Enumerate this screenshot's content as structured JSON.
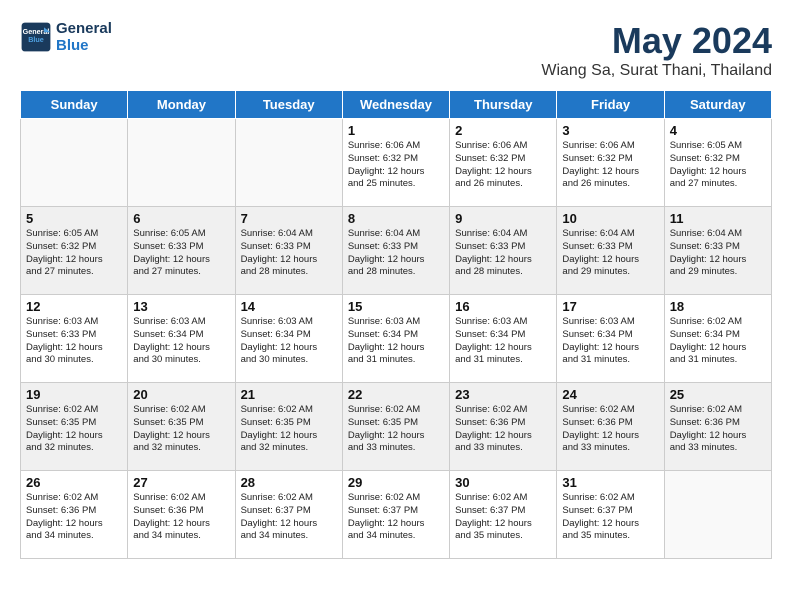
{
  "header": {
    "logo_line1": "General",
    "logo_line2": "Blue",
    "title": "May 2024",
    "subtitle": "Wiang Sa, Surat Thani, Thailand"
  },
  "days_of_week": [
    "Sunday",
    "Monday",
    "Tuesday",
    "Wednesday",
    "Thursday",
    "Friday",
    "Saturday"
  ],
  "weeks": [
    [
      {
        "num": "",
        "info": ""
      },
      {
        "num": "",
        "info": ""
      },
      {
        "num": "",
        "info": ""
      },
      {
        "num": "1",
        "info": "Sunrise: 6:06 AM\nSunset: 6:32 PM\nDaylight: 12 hours\nand 25 minutes."
      },
      {
        "num": "2",
        "info": "Sunrise: 6:06 AM\nSunset: 6:32 PM\nDaylight: 12 hours\nand 26 minutes."
      },
      {
        "num": "3",
        "info": "Sunrise: 6:06 AM\nSunset: 6:32 PM\nDaylight: 12 hours\nand 26 minutes."
      },
      {
        "num": "4",
        "info": "Sunrise: 6:05 AM\nSunset: 6:32 PM\nDaylight: 12 hours\nand 27 minutes."
      }
    ],
    [
      {
        "num": "5",
        "info": "Sunrise: 6:05 AM\nSunset: 6:32 PM\nDaylight: 12 hours\nand 27 minutes."
      },
      {
        "num": "6",
        "info": "Sunrise: 6:05 AM\nSunset: 6:33 PM\nDaylight: 12 hours\nand 27 minutes."
      },
      {
        "num": "7",
        "info": "Sunrise: 6:04 AM\nSunset: 6:33 PM\nDaylight: 12 hours\nand 28 minutes."
      },
      {
        "num": "8",
        "info": "Sunrise: 6:04 AM\nSunset: 6:33 PM\nDaylight: 12 hours\nand 28 minutes."
      },
      {
        "num": "9",
        "info": "Sunrise: 6:04 AM\nSunset: 6:33 PM\nDaylight: 12 hours\nand 28 minutes."
      },
      {
        "num": "10",
        "info": "Sunrise: 6:04 AM\nSunset: 6:33 PM\nDaylight: 12 hours\nand 29 minutes."
      },
      {
        "num": "11",
        "info": "Sunrise: 6:04 AM\nSunset: 6:33 PM\nDaylight: 12 hours\nand 29 minutes."
      }
    ],
    [
      {
        "num": "12",
        "info": "Sunrise: 6:03 AM\nSunset: 6:33 PM\nDaylight: 12 hours\nand 30 minutes."
      },
      {
        "num": "13",
        "info": "Sunrise: 6:03 AM\nSunset: 6:34 PM\nDaylight: 12 hours\nand 30 minutes."
      },
      {
        "num": "14",
        "info": "Sunrise: 6:03 AM\nSunset: 6:34 PM\nDaylight: 12 hours\nand 30 minutes."
      },
      {
        "num": "15",
        "info": "Sunrise: 6:03 AM\nSunset: 6:34 PM\nDaylight: 12 hours\nand 31 minutes."
      },
      {
        "num": "16",
        "info": "Sunrise: 6:03 AM\nSunset: 6:34 PM\nDaylight: 12 hours\nand 31 minutes."
      },
      {
        "num": "17",
        "info": "Sunrise: 6:03 AM\nSunset: 6:34 PM\nDaylight: 12 hours\nand 31 minutes."
      },
      {
        "num": "18",
        "info": "Sunrise: 6:02 AM\nSunset: 6:34 PM\nDaylight: 12 hours\nand 31 minutes."
      }
    ],
    [
      {
        "num": "19",
        "info": "Sunrise: 6:02 AM\nSunset: 6:35 PM\nDaylight: 12 hours\nand 32 minutes."
      },
      {
        "num": "20",
        "info": "Sunrise: 6:02 AM\nSunset: 6:35 PM\nDaylight: 12 hours\nand 32 minutes."
      },
      {
        "num": "21",
        "info": "Sunrise: 6:02 AM\nSunset: 6:35 PM\nDaylight: 12 hours\nand 32 minutes."
      },
      {
        "num": "22",
        "info": "Sunrise: 6:02 AM\nSunset: 6:35 PM\nDaylight: 12 hours\nand 33 minutes."
      },
      {
        "num": "23",
        "info": "Sunrise: 6:02 AM\nSunset: 6:36 PM\nDaylight: 12 hours\nand 33 minutes."
      },
      {
        "num": "24",
        "info": "Sunrise: 6:02 AM\nSunset: 6:36 PM\nDaylight: 12 hours\nand 33 minutes."
      },
      {
        "num": "25",
        "info": "Sunrise: 6:02 AM\nSunset: 6:36 PM\nDaylight: 12 hours\nand 33 minutes."
      }
    ],
    [
      {
        "num": "26",
        "info": "Sunrise: 6:02 AM\nSunset: 6:36 PM\nDaylight: 12 hours\nand 34 minutes."
      },
      {
        "num": "27",
        "info": "Sunrise: 6:02 AM\nSunset: 6:36 PM\nDaylight: 12 hours\nand 34 minutes."
      },
      {
        "num": "28",
        "info": "Sunrise: 6:02 AM\nSunset: 6:37 PM\nDaylight: 12 hours\nand 34 minutes."
      },
      {
        "num": "29",
        "info": "Sunrise: 6:02 AM\nSunset: 6:37 PM\nDaylight: 12 hours\nand 34 minutes."
      },
      {
        "num": "30",
        "info": "Sunrise: 6:02 AM\nSunset: 6:37 PM\nDaylight: 12 hours\nand 35 minutes."
      },
      {
        "num": "31",
        "info": "Sunrise: 6:02 AM\nSunset: 6:37 PM\nDaylight: 12 hours\nand 35 minutes."
      },
      {
        "num": "",
        "info": ""
      }
    ]
  ]
}
